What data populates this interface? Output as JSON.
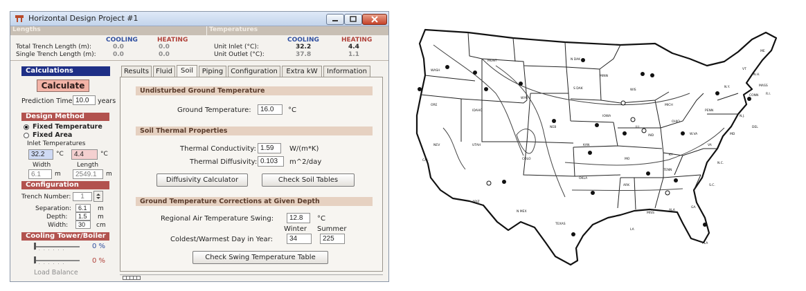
{
  "window": {
    "title": "Horizontal Design Project #1"
  },
  "lengths": {
    "header": "Lengths",
    "cooling_label": "COOLING",
    "heating_label": "HEATING",
    "rows": [
      {
        "label": "Total Trench Length (m):",
        "cooling": "0.0",
        "heating": "0.0"
      },
      {
        "label": "Single Trench Length (m):",
        "cooling": "0.0",
        "heating": "0.0"
      }
    ]
  },
  "temperatures": {
    "header": "Temperatures",
    "cooling_label": "COOLING",
    "heating_label": "HEATING",
    "rows": [
      {
        "label": "Unit Inlet (°C):",
        "cooling": "32.2",
        "heating": "4.4"
      },
      {
        "label": "Unit Outlet (°C):",
        "cooling": "37.8",
        "heating": "1.1"
      }
    ]
  },
  "left": {
    "calculations_header": "Calculations",
    "calculate_button": "Calculate",
    "prediction_label": "Prediction Time:",
    "prediction_value": "10.0",
    "prediction_unit": "years",
    "design_method_header": "Design Method",
    "method_options": [
      {
        "label": "Fixed Temperature",
        "selected": true
      },
      {
        "label": "Fixed Area",
        "selected": false
      }
    ],
    "inlet_label": "Inlet Temperatures",
    "inlet_cool": "32.2",
    "inlet_heat": "4.4",
    "unit_c": "°C",
    "width_label": "Width",
    "length_label": "Length",
    "width_value": "6.1",
    "length_value": "2549.1",
    "unit_m": "m",
    "configuration_header": "Configuration",
    "trench_label": "Trench Number:",
    "trench_value": "1",
    "separation_label": "Separation:",
    "separation_value": "6.1",
    "depth_label": "Depth:",
    "depth_value": "1.5",
    "width2_label": "Width:",
    "width2_value": "30",
    "unit_cm": "cm",
    "tower_header": "Cooling Tower/Boiler",
    "tower_pct": "0 %",
    "boiler_pct": "0 %",
    "tower_level": 0,
    "boiler_level": 0,
    "load_balance": "Load Balance"
  },
  "tabs": [
    {
      "label": "Results"
    },
    {
      "label": "Fluid"
    },
    {
      "label": "Soil"
    },
    {
      "label": "Piping"
    },
    {
      "label": "Configuration"
    },
    {
      "label": "Extra kW"
    },
    {
      "label": "Information"
    }
  ],
  "soil": {
    "undisturbed_header": "Undisturbed Ground Temperature",
    "ground_temp_label": "Ground Temperature:",
    "ground_temp_value": "16.0",
    "ground_temp_unit": "°C",
    "thermal_header": "Soil Thermal Properties",
    "conductivity_label": "Thermal Conductivity:",
    "conductivity_value": "1.59",
    "conductivity_unit": "W/(m*K)",
    "diffusivity_label": "Thermal Diffusivity:",
    "diffusivity_value": "0.103",
    "diffusivity_unit": "m^2/day",
    "diffusivity_button": "Diffusivity Calculator",
    "soil_tables_button": "Check Soil Tables",
    "corrections_header": "Ground Temperature Corrections at Given Depth",
    "swing_label": "Regional Air Temperature Swing:",
    "swing_value": "12.8",
    "swing_unit": "°C",
    "winter_label": "Winter",
    "summer_label": "Summer",
    "day_label": "Coldest/Warmest Day in Year:",
    "winter_value": "34",
    "summer_value": "225",
    "swing_table_button": "Check Swing Temperature Table"
  },
  "map": {
    "labels": [
      "WASH",
      "MONT",
      "N DAK",
      "MINN",
      "ORE",
      "IDAHO",
      "S DAK",
      "WYO",
      "WIS",
      "MICH",
      "N.Y.",
      "ME",
      "IOWA",
      "NEB",
      "PENN",
      "N.J.",
      "NEV",
      "UTAH",
      "COLO",
      "ILL",
      "IND",
      "OHIO",
      "W.VA",
      "VA",
      "KAN",
      "MO",
      "KY",
      "CAL",
      "OKLA",
      "TENN",
      "N.C.",
      "ARK",
      "ARIZ",
      "N MEX",
      "S.C.",
      "MISS",
      "ALA",
      "GA",
      "TEXAS",
      "LA",
      "FLA",
      "MD",
      "DEL",
      "CONN",
      "MASS",
      "VT",
      "N.H.",
      "R.I."
    ]
  }
}
